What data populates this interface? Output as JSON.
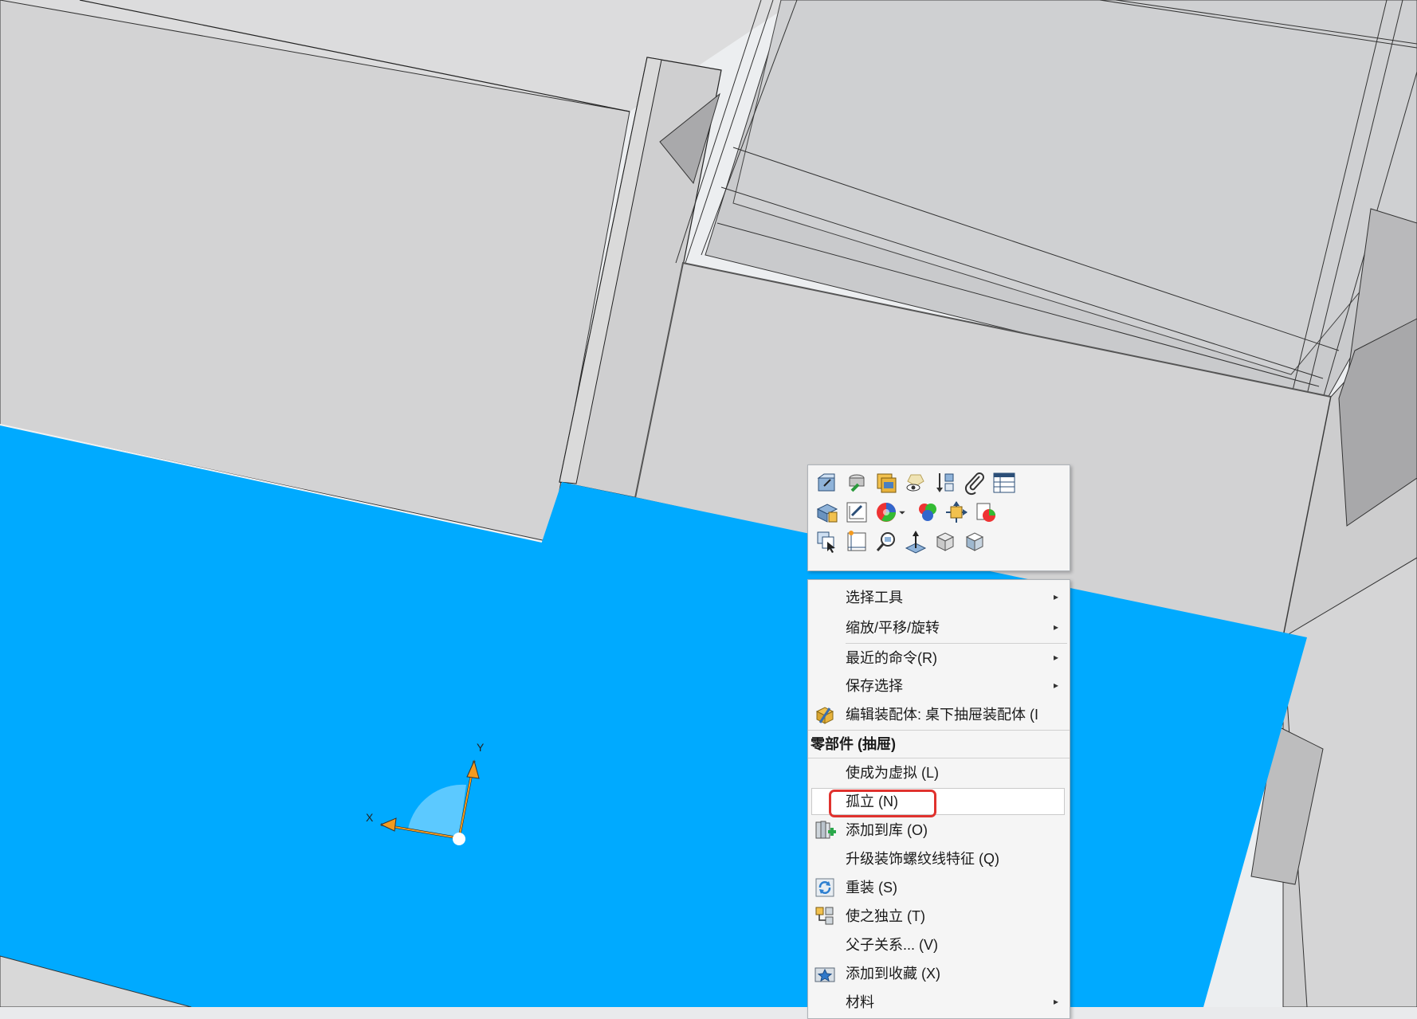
{
  "triad": {
    "x_label": "X",
    "y_label": "Y"
  },
  "colors": {
    "selected_face": "#00aaff",
    "highlight_border": "#e0322e",
    "part_gray": "#d6d7d9"
  },
  "toolbar": {
    "icons": [
      "open-part-icon",
      "edit-feature-icon",
      "open-assembly-icon",
      "hide-show-icon",
      "move-down-icon",
      "paperclip-icon",
      "properties-table-icon",
      "component-props-icon",
      "edit-sketch-icon",
      "appearance-icon",
      "dropdown-arrow-icon",
      "appearance-colors-icon",
      "move-component-icon",
      "material-icon",
      "select-other-icon",
      "sketch-plane-icon",
      "zoom-to-selection-icon",
      "normal-to-icon",
      "view-orientation-icon",
      "isometric-view-icon"
    ]
  },
  "menu": {
    "items": {
      "select_tools": "选择工具",
      "zoom_pan_rotate": "缩放/平移/旋转",
      "recent_commands": "最近的命令(R)",
      "save_selection": "保存选择",
      "edit_assembly": "编辑装配体: 桌下抽屉装配体 (I",
      "section_header": "零部件 (抽屉)",
      "make_virtual": "使成为虚拟 (L)",
      "isolate": "孤立 (N)",
      "add_to_library": "添加到库 (O)",
      "upgrade_thread": "升级装饰螺纹线特征 (Q)",
      "reload": "重装 (S)",
      "make_independent": "使之独立 (T)",
      "parent_child": "父子关系... (V)",
      "add_to_favorites": "添加到收藏 (X)",
      "material": "材料"
    }
  }
}
